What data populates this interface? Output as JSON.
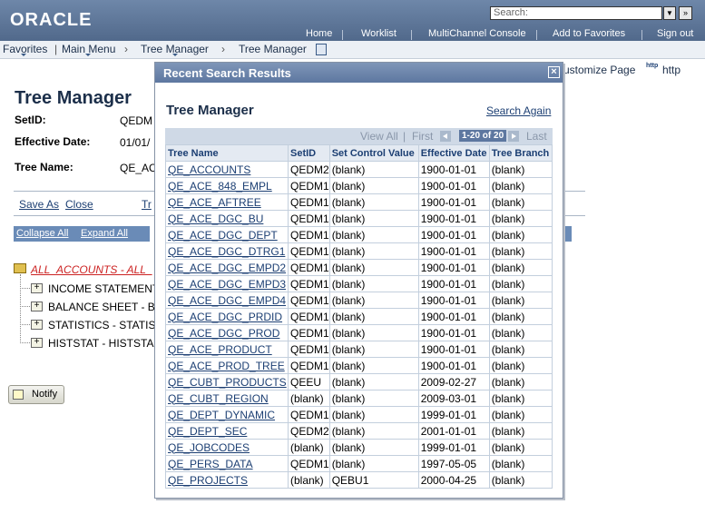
{
  "header": {
    "logo": "ORACLE",
    "search_placeholder": "Search:",
    "links": [
      "Home",
      "Worklist",
      "MultiChannel Console",
      "Add to Favorites",
      "Sign out"
    ]
  },
  "nav": {
    "items": [
      "Favorites",
      "Main Menu",
      "Tree Manager",
      "Tree Manager"
    ]
  },
  "page": {
    "title": "Tree Manager",
    "setid_label": "SetID:",
    "setid_value": "QEDM",
    "effective_date_label": "Effective Date:",
    "effective_date_value": "01/01/",
    "tree_name_label": "Tree Name:",
    "tree_name_value": "QE_AC",
    "save_as": "Save As",
    "close": "Close",
    "partial_link": "Tr",
    "collapse_all": "Collapse All",
    "expand_all": "Expand All",
    "customize_page": "ustomize Page",
    "http": "http",
    "http_icon_text": "http",
    "tree_root": "ALL_ACCOUNTS - ALL_",
    "tree_items": [
      "INCOME STATEMENT",
      "BALANCE SHEET - B",
      "STATISTICS - STATIS",
      "HISTSTAT - HISTSTA"
    ],
    "notify": "Notify"
  },
  "modal": {
    "title": "Recent Search Results",
    "subtitle": "Tree Manager",
    "search_again": "Search Again",
    "pager": {
      "view_all": "View All",
      "first": "First",
      "count": "1-20 of 20",
      "last": "Last"
    },
    "columns": [
      "Tree Name",
      "SetID",
      "Set Control Value",
      "Effective Date",
      "Tree Branch"
    ],
    "rows": [
      [
        "QE_ACCOUNTS",
        "QEDM2",
        "(blank)",
        "1900-01-01",
        "(blank)"
      ],
      [
        "QE_ACE_848_EMPL",
        "QEDM1",
        "(blank)",
        "1900-01-01",
        "(blank)"
      ],
      [
        "QE_ACE_AFTREE",
        "QEDM1",
        "(blank)",
        "1900-01-01",
        "(blank)"
      ],
      [
        "QE_ACE_DGC_BU",
        "QEDM1",
        "(blank)",
        "1900-01-01",
        "(blank)"
      ],
      [
        "QE_ACE_DGC_DEPT",
        "QEDM1",
        "(blank)",
        "1900-01-01",
        "(blank)"
      ],
      [
        "QE_ACE_DGC_DTRG1",
        "QEDM1",
        "(blank)",
        "1900-01-01",
        "(blank)"
      ],
      [
        "QE_ACE_DGC_EMPD2",
        "QEDM1",
        "(blank)",
        "1900-01-01",
        "(blank)"
      ],
      [
        "QE_ACE_DGC_EMPD3",
        "QEDM1",
        "(blank)",
        "1900-01-01",
        "(blank)"
      ],
      [
        "QE_ACE_DGC_EMPD4",
        "QEDM1",
        "(blank)",
        "1900-01-01",
        "(blank)"
      ],
      [
        "QE_ACE_DGC_PRDID",
        "QEDM1",
        "(blank)",
        "1900-01-01",
        "(blank)"
      ],
      [
        "QE_ACE_DGC_PROD",
        "QEDM1",
        "(blank)",
        "1900-01-01",
        "(blank)"
      ],
      [
        "QE_ACE_PRODUCT",
        "QEDM1",
        "(blank)",
        "1900-01-01",
        "(blank)"
      ],
      [
        "QE_ACE_PROD_TREE",
        "QEDM1",
        "(blank)",
        "1900-01-01",
        "(blank)"
      ],
      [
        "QE_CUBT_PRODUCTS",
        "QEEU",
        "(blank)",
        "2009-02-27",
        "(blank)"
      ],
      [
        "QE_CUBT_REGION",
        "(blank)",
        "(blank)",
        "2009-03-01",
        "(blank)"
      ],
      [
        "QE_DEPT_DYNAMIC",
        "QEDM1",
        "(blank)",
        "1999-01-01",
        "(blank)"
      ],
      [
        "QE_DEPT_SEC",
        "QEDM2",
        "(blank)",
        "2001-01-01",
        "(blank)"
      ],
      [
        "QE_JOBCODES",
        "(blank)",
        "(blank)",
        "1999-01-01",
        "(blank)"
      ],
      [
        "QE_PERS_DATA",
        "QEDM1",
        "(blank)",
        "1997-05-05",
        "(blank)"
      ],
      [
        "QE_PROJECTS",
        "(blank)",
        "QEBU1",
        "2000-04-25",
        "(blank)"
      ]
    ]
  }
}
